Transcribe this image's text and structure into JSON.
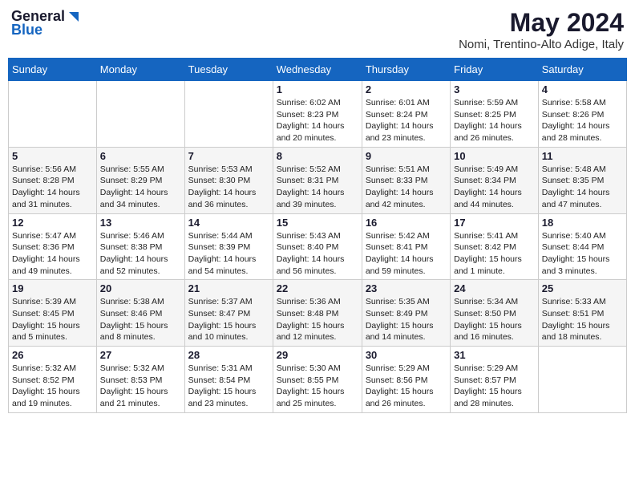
{
  "header": {
    "logo_general": "General",
    "logo_blue": "Blue",
    "month_year": "May 2024",
    "location": "Nomi, Trentino-Alto Adige, Italy"
  },
  "days_of_week": [
    "Sunday",
    "Monday",
    "Tuesday",
    "Wednesday",
    "Thursday",
    "Friday",
    "Saturday"
  ],
  "weeks": [
    [
      {
        "day": "",
        "info": ""
      },
      {
        "day": "",
        "info": ""
      },
      {
        "day": "",
        "info": ""
      },
      {
        "day": "1",
        "info": "Sunrise: 6:02 AM\nSunset: 8:23 PM\nDaylight: 14 hours\nand 20 minutes."
      },
      {
        "day": "2",
        "info": "Sunrise: 6:01 AM\nSunset: 8:24 PM\nDaylight: 14 hours\nand 23 minutes."
      },
      {
        "day": "3",
        "info": "Sunrise: 5:59 AM\nSunset: 8:25 PM\nDaylight: 14 hours\nand 26 minutes."
      },
      {
        "day": "4",
        "info": "Sunrise: 5:58 AM\nSunset: 8:26 PM\nDaylight: 14 hours\nand 28 minutes."
      }
    ],
    [
      {
        "day": "5",
        "info": "Sunrise: 5:56 AM\nSunset: 8:28 PM\nDaylight: 14 hours\nand 31 minutes."
      },
      {
        "day": "6",
        "info": "Sunrise: 5:55 AM\nSunset: 8:29 PM\nDaylight: 14 hours\nand 34 minutes."
      },
      {
        "day": "7",
        "info": "Sunrise: 5:53 AM\nSunset: 8:30 PM\nDaylight: 14 hours\nand 36 minutes."
      },
      {
        "day": "8",
        "info": "Sunrise: 5:52 AM\nSunset: 8:31 PM\nDaylight: 14 hours\nand 39 minutes."
      },
      {
        "day": "9",
        "info": "Sunrise: 5:51 AM\nSunset: 8:33 PM\nDaylight: 14 hours\nand 42 minutes."
      },
      {
        "day": "10",
        "info": "Sunrise: 5:49 AM\nSunset: 8:34 PM\nDaylight: 14 hours\nand 44 minutes."
      },
      {
        "day": "11",
        "info": "Sunrise: 5:48 AM\nSunset: 8:35 PM\nDaylight: 14 hours\nand 47 minutes."
      }
    ],
    [
      {
        "day": "12",
        "info": "Sunrise: 5:47 AM\nSunset: 8:36 PM\nDaylight: 14 hours\nand 49 minutes."
      },
      {
        "day": "13",
        "info": "Sunrise: 5:46 AM\nSunset: 8:38 PM\nDaylight: 14 hours\nand 52 minutes."
      },
      {
        "day": "14",
        "info": "Sunrise: 5:44 AM\nSunset: 8:39 PM\nDaylight: 14 hours\nand 54 minutes."
      },
      {
        "day": "15",
        "info": "Sunrise: 5:43 AM\nSunset: 8:40 PM\nDaylight: 14 hours\nand 56 minutes."
      },
      {
        "day": "16",
        "info": "Sunrise: 5:42 AM\nSunset: 8:41 PM\nDaylight: 14 hours\nand 59 minutes."
      },
      {
        "day": "17",
        "info": "Sunrise: 5:41 AM\nSunset: 8:42 PM\nDaylight: 15 hours\nand 1 minute."
      },
      {
        "day": "18",
        "info": "Sunrise: 5:40 AM\nSunset: 8:44 PM\nDaylight: 15 hours\nand 3 minutes."
      }
    ],
    [
      {
        "day": "19",
        "info": "Sunrise: 5:39 AM\nSunset: 8:45 PM\nDaylight: 15 hours\nand 5 minutes."
      },
      {
        "day": "20",
        "info": "Sunrise: 5:38 AM\nSunset: 8:46 PM\nDaylight: 15 hours\nand 8 minutes."
      },
      {
        "day": "21",
        "info": "Sunrise: 5:37 AM\nSunset: 8:47 PM\nDaylight: 15 hours\nand 10 minutes."
      },
      {
        "day": "22",
        "info": "Sunrise: 5:36 AM\nSunset: 8:48 PM\nDaylight: 15 hours\nand 12 minutes."
      },
      {
        "day": "23",
        "info": "Sunrise: 5:35 AM\nSunset: 8:49 PM\nDaylight: 15 hours\nand 14 minutes."
      },
      {
        "day": "24",
        "info": "Sunrise: 5:34 AM\nSunset: 8:50 PM\nDaylight: 15 hours\nand 16 minutes."
      },
      {
        "day": "25",
        "info": "Sunrise: 5:33 AM\nSunset: 8:51 PM\nDaylight: 15 hours\nand 18 minutes."
      }
    ],
    [
      {
        "day": "26",
        "info": "Sunrise: 5:32 AM\nSunset: 8:52 PM\nDaylight: 15 hours\nand 19 minutes."
      },
      {
        "day": "27",
        "info": "Sunrise: 5:32 AM\nSunset: 8:53 PM\nDaylight: 15 hours\nand 21 minutes."
      },
      {
        "day": "28",
        "info": "Sunrise: 5:31 AM\nSunset: 8:54 PM\nDaylight: 15 hours\nand 23 minutes."
      },
      {
        "day": "29",
        "info": "Sunrise: 5:30 AM\nSunset: 8:55 PM\nDaylight: 15 hours\nand 25 minutes."
      },
      {
        "day": "30",
        "info": "Sunrise: 5:29 AM\nSunset: 8:56 PM\nDaylight: 15 hours\nand 26 minutes."
      },
      {
        "day": "31",
        "info": "Sunrise: 5:29 AM\nSunset: 8:57 PM\nDaylight: 15 hours\nand 28 minutes."
      },
      {
        "day": "",
        "info": ""
      }
    ]
  ]
}
